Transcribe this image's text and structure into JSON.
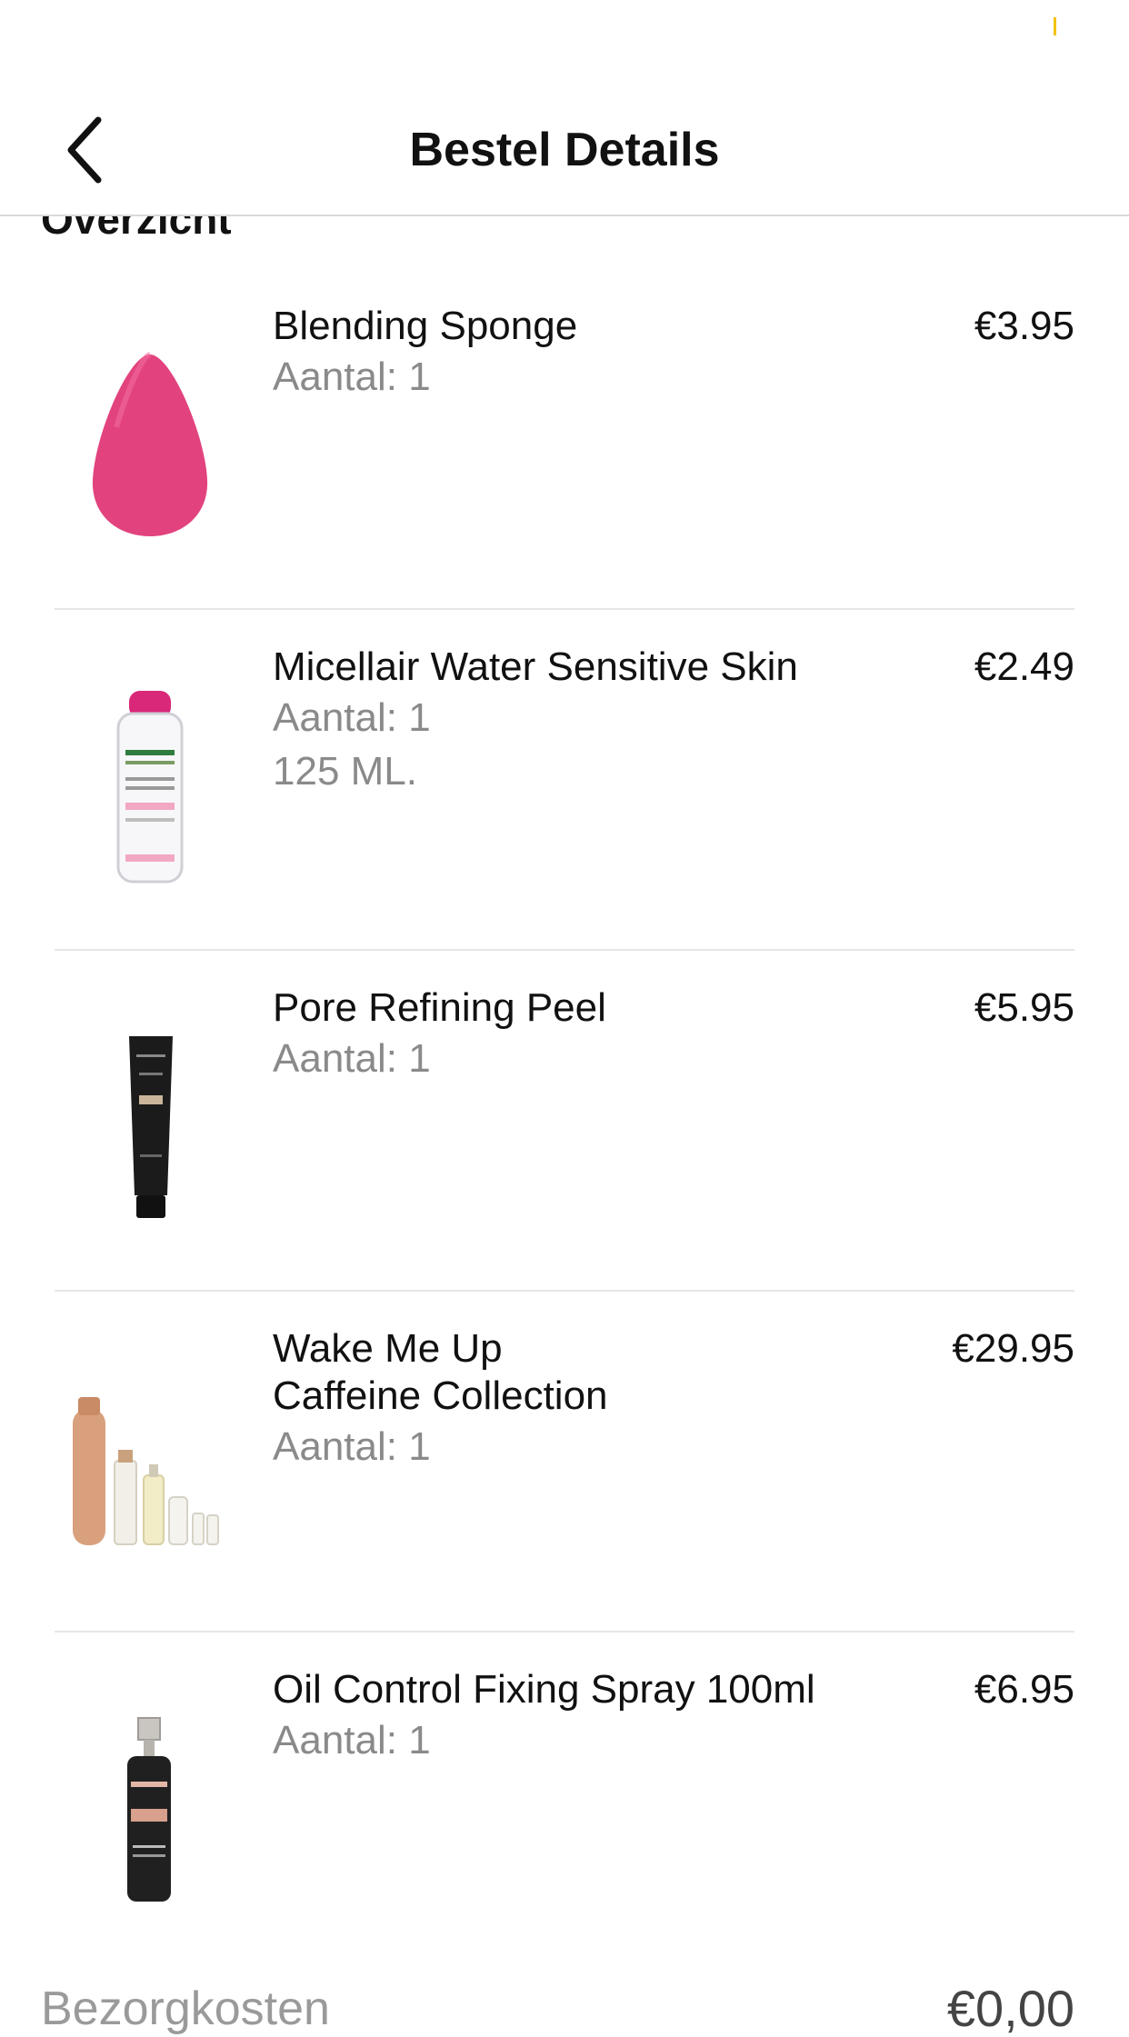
{
  "header": {
    "title": "Bestel Details"
  },
  "section": {
    "title": "Overzicht"
  },
  "items": [
    {
      "name": "Blending Sponge",
      "quantity": "Aantal: 1",
      "price": "€3.95",
      "image": "blending-sponge-image"
    },
    {
      "name": "Micellair Water Sensitive Skin",
      "quantity": "Aantal: 1",
      "variant": "125 ML.",
      "price": "€2.49",
      "image": "micellar-water-bottle-image"
    },
    {
      "name": "Pore Refining Peel",
      "quantity": "Aantal: 1",
      "price": "€5.95",
      "image": "peel-tube-image"
    },
    {
      "name_line1": "Wake Me Up",
      "name_line2": "Caffeine Collection",
      "quantity": "Aantal: 1",
      "price": "€29.95",
      "image": "caffeine-collection-image"
    },
    {
      "name": "Oil Control Fixing Spray 100ml",
      "quantity": "Aantal: 1",
      "price": "€6.95",
      "image": "fixing-spray-image"
    }
  ],
  "summary": {
    "label": "Bezorgkosten",
    "value": "€0,00"
  },
  "colors": {
    "accent": "#f4c20d",
    "sponge": "#e2437f",
    "divider": "#e6e6e6",
    "muted": "#8a8a8a"
  }
}
